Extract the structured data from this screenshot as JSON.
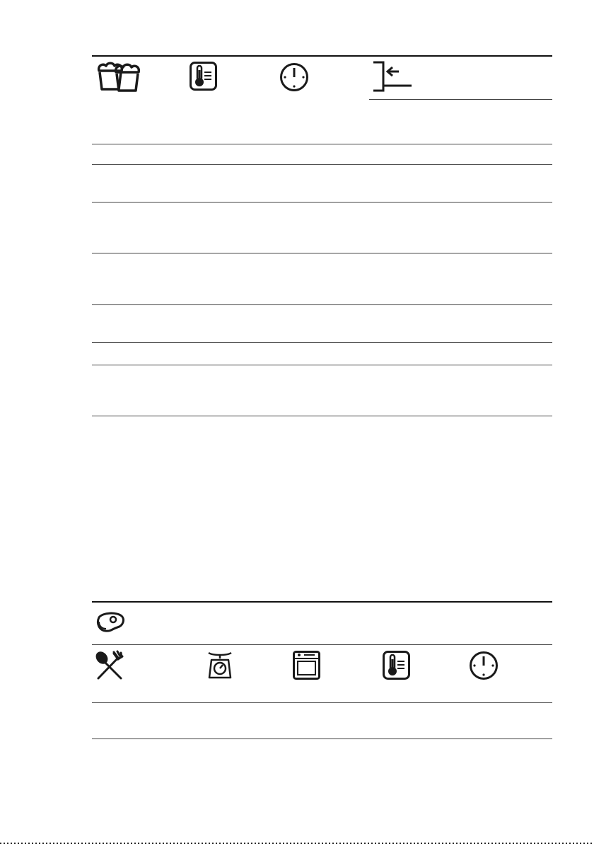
{
  "table1": {
    "header_icons": [
      "baked-goods-icon",
      "thermometer-icon",
      "clock-icon",
      "shelf-position-icon"
    ],
    "row_count": 7
  },
  "table2": {
    "header_icons": [
      "meat-steak-icon"
    ],
    "subheader_icons": [
      "cutlery-icon",
      "kitchen-scale-icon",
      "oven-icon",
      "thermometer-icon",
      "clock-icon"
    ],
    "row_count": 1
  },
  "colors": {
    "lines": "#1f1f1f",
    "icon_stroke": "#1a1a1a"
  }
}
